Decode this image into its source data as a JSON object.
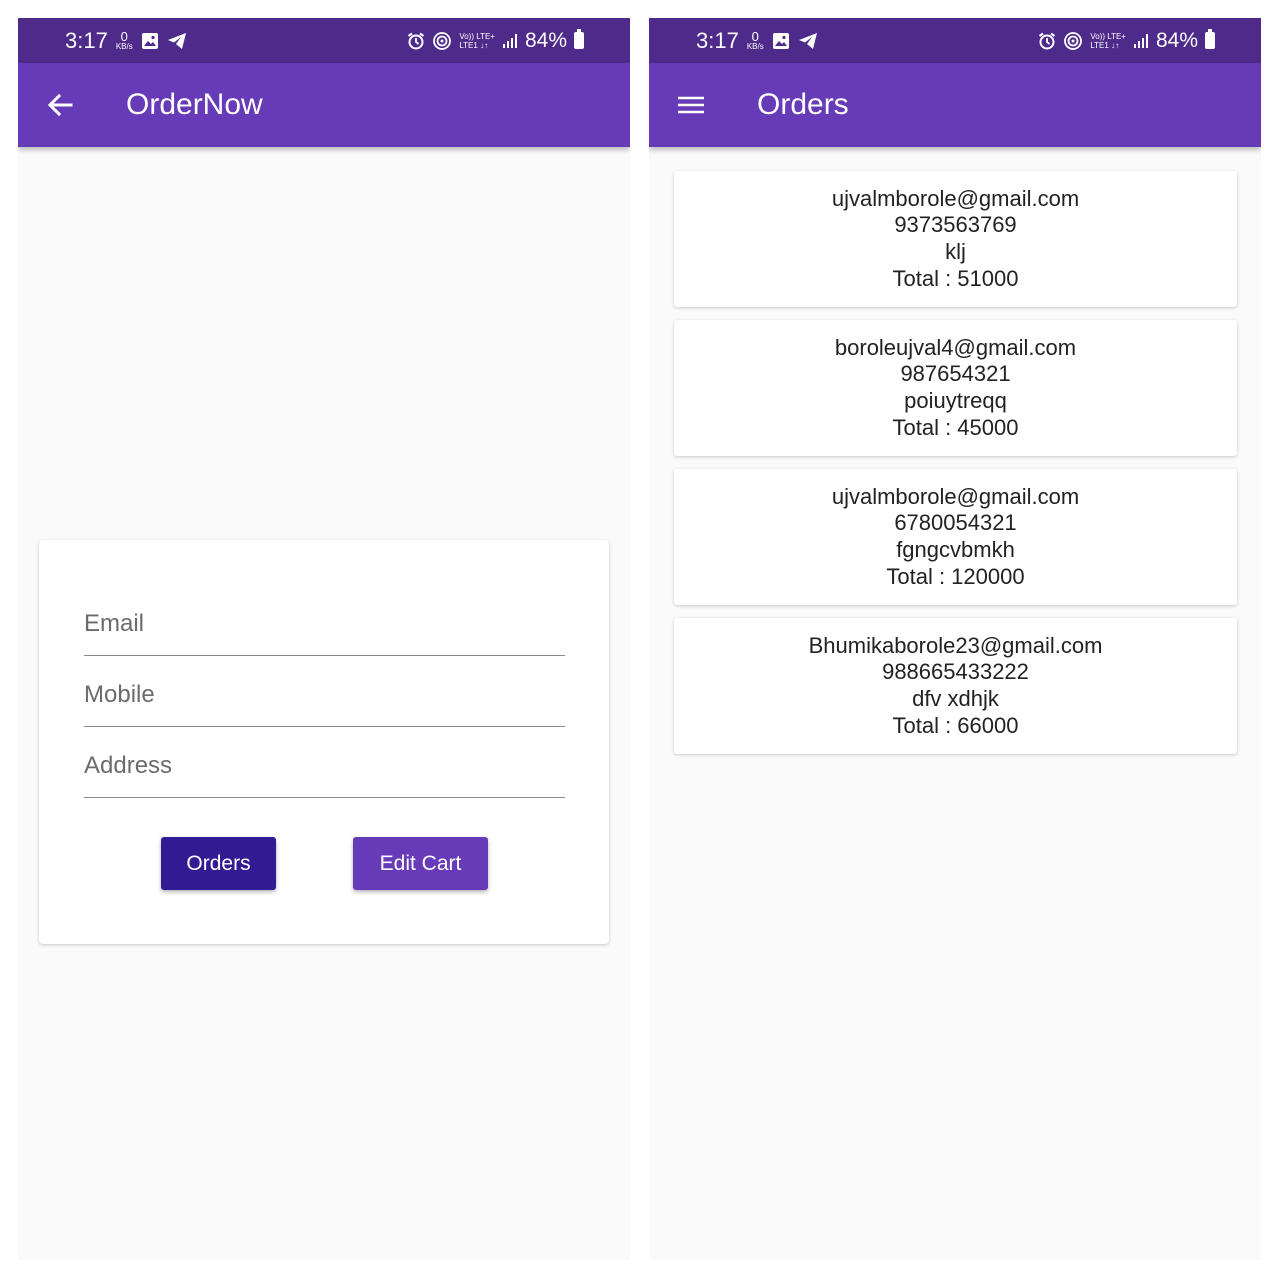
{
  "colors": {
    "status_bar": "#4e2a8a",
    "app_bar": "#673ab7",
    "orders_button": "#311b92",
    "edit_cart_button": "#673ab7",
    "background": "#fafafa"
  },
  "status_bar": {
    "time": "3:17",
    "data_speed_value": "0",
    "data_speed_unit": "KB/s",
    "volte_top": "Vo)) LTE+",
    "volte_bottom": "LTE1 ↓↑",
    "battery": "84%"
  },
  "order_now_screen": {
    "app_bar": {
      "nav_icon": "back-arrow-icon",
      "title": "OrderNow"
    },
    "form": {
      "email_placeholder": "Email",
      "mobile_placeholder": "Mobile",
      "address_placeholder": "Address",
      "orders_button": "Orders",
      "edit_cart_button": "Edit Cart"
    }
  },
  "orders_screen": {
    "app_bar": {
      "nav_icon": "menu-icon",
      "title": "Orders"
    },
    "orders": [
      {
        "email": "ujvalmborole@gmail.com",
        "mobile": "9373563769",
        "address": "klj",
        "total": "Total : 51000"
      },
      {
        "email": "boroleujval4@gmail.com",
        "mobile": "987654321",
        "address": "poiuytreqq",
        "total": "Total : 45000"
      },
      {
        "email": "ujvalmborole@gmail.com",
        "mobile": "6780054321",
        "address": "fgngcvbmkh",
        "total": "Total : 120000"
      },
      {
        "email": "Bhumikaborole23@gmail.com",
        "mobile": "988665433222",
        "address": "dfv xdhjk",
        "total": "Total : 66000"
      }
    ]
  }
}
